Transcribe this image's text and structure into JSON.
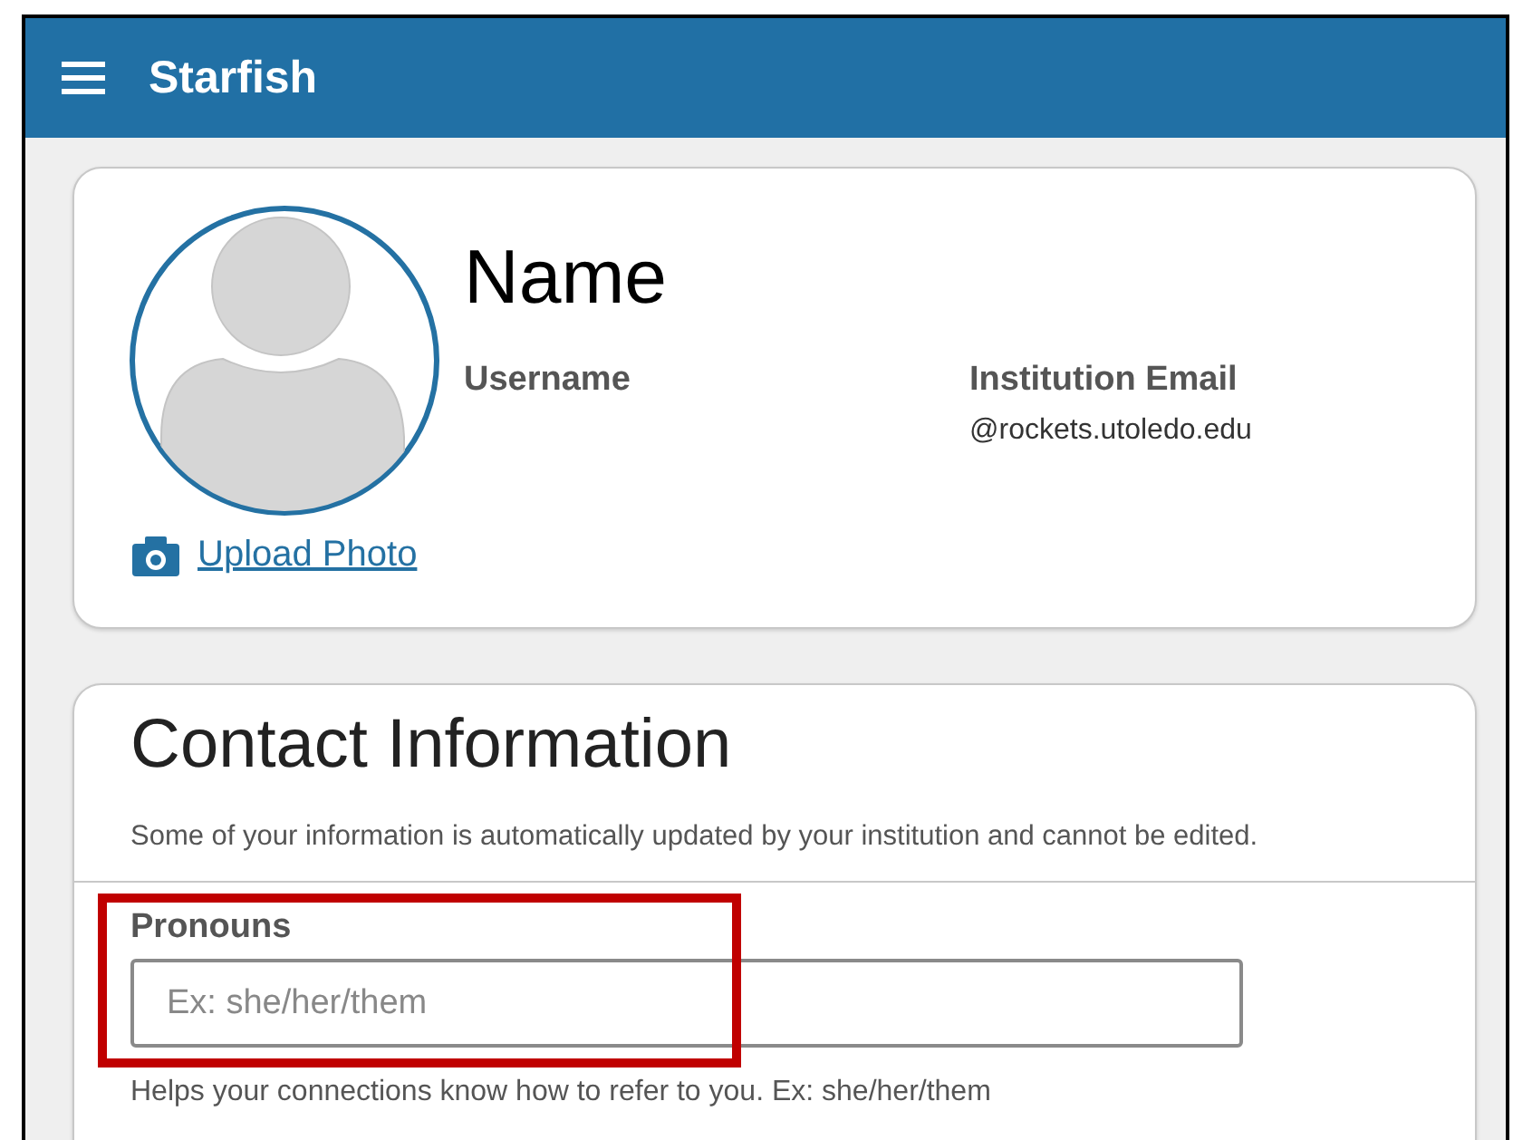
{
  "header": {
    "title": "Starfish"
  },
  "profile": {
    "name": "Name",
    "fields": [
      {
        "label": "Username"
      },
      {
        "label": "Institution Email",
        "value": "@rockets.utoledo.edu"
      }
    ],
    "upload_link": "Upload Photo"
  },
  "contact": {
    "title": "Contact Information",
    "note": "Some of your information is automatically updated by your institution and cannot be edited.",
    "pronouns": {
      "label": "Pronouns",
      "placeholder": "Ex: she/her/them",
      "help": "Helps your connections know how to refer to you. Ex: she/her/them",
      "highlighted": true
    }
  }
}
